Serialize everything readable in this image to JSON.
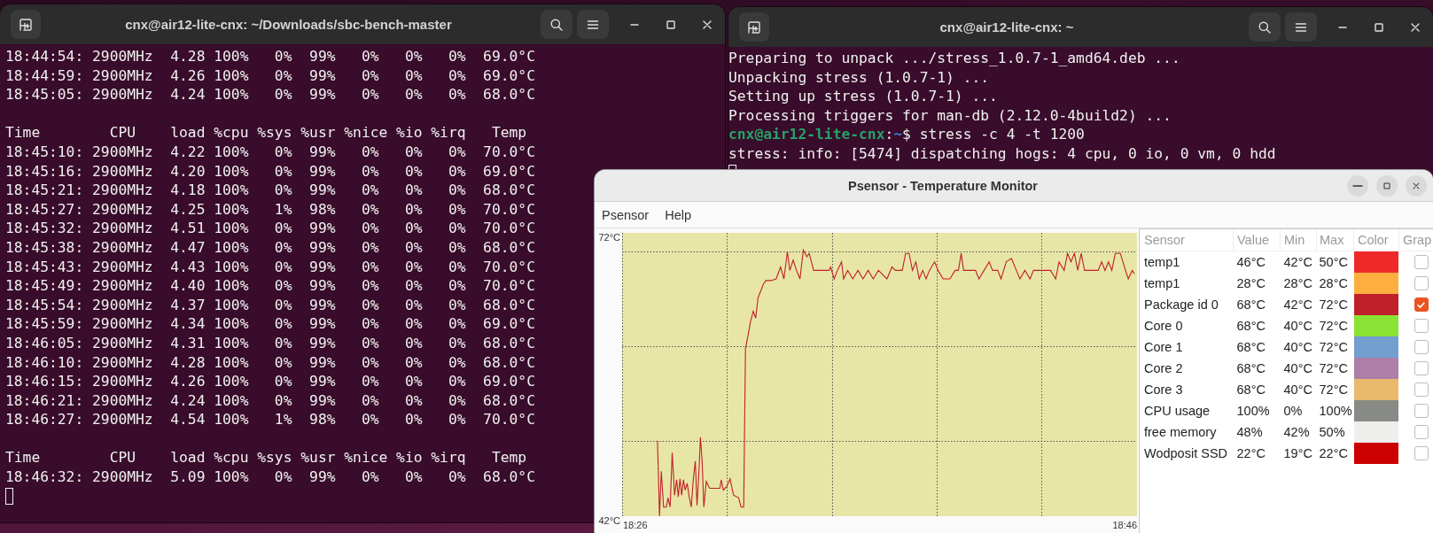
{
  "terminals": [
    {
      "title": "cnx@air12-lite-cnx: ~/Downloads/sbc-bench-master",
      "lines": [
        {
          "kind": "output",
          "text": "18:44:54: 2900MHz  4.28 100%   0%  99%   0%   0%   0%  69.0°C"
        },
        {
          "kind": "output",
          "text": "18:44:59: 2900MHz  4.26 100%   0%  99%   0%   0%   0%  69.0°C"
        },
        {
          "kind": "output",
          "text": "18:45:05: 2900MHz  4.24 100%   0%  99%   0%   0%   0%  68.0°C"
        },
        {
          "kind": "blank"
        },
        {
          "kind": "output",
          "text": "Time        CPU    load %cpu %sys %usr %nice %io %irq   Temp"
        },
        {
          "kind": "output",
          "text": "18:45:10: 2900MHz  4.22 100%   0%  99%   0%   0%   0%  70.0°C"
        },
        {
          "kind": "output",
          "text": "18:45:16: 2900MHz  4.20 100%   0%  99%   0%   0%   0%  69.0°C"
        },
        {
          "kind": "output",
          "text": "18:45:21: 2900MHz  4.18 100%   0%  99%   0%   0%   0%  68.0°C"
        },
        {
          "kind": "output",
          "text": "18:45:27: 2900MHz  4.25 100%   1%  98%   0%   0%   0%  70.0°C"
        },
        {
          "kind": "output",
          "text": "18:45:32: 2900MHz  4.51 100%   0%  99%   0%   0%   0%  70.0°C"
        },
        {
          "kind": "output",
          "text": "18:45:38: 2900MHz  4.47 100%   0%  99%   0%   0%   0%  68.0°C"
        },
        {
          "kind": "output",
          "text": "18:45:43: 2900MHz  4.43 100%   0%  99%   0%   0%   0%  70.0°C"
        },
        {
          "kind": "output",
          "text": "18:45:49: 2900MHz  4.40 100%   0%  99%   0%   0%   0%  70.0°C"
        },
        {
          "kind": "output",
          "text": "18:45:54: 2900MHz  4.37 100%   0%  99%   0%   0%   0%  68.0°C"
        },
        {
          "kind": "output",
          "text": "18:45:59: 2900MHz  4.34 100%   0%  99%   0%   0%   0%  69.0°C"
        },
        {
          "kind": "output",
          "text": "18:46:05: 2900MHz  4.31 100%   0%  99%   0%   0%   0%  68.0°C"
        },
        {
          "kind": "output",
          "text": "18:46:10: 2900MHz  4.28 100%   0%  99%   0%   0%   0%  68.0°C"
        },
        {
          "kind": "output",
          "text": "18:46:15: 2900MHz  4.26 100%   0%  99%   0%   0%   0%  69.0°C"
        },
        {
          "kind": "output",
          "text": "18:46:21: 2900MHz  4.24 100%   0%  99%   0%   0%   0%  68.0°C"
        },
        {
          "kind": "output",
          "text": "18:46:27: 2900MHz  4.54 100%   1%  98%   0%   0%   0%  70.0°C"
        },
        {
          "kind": "blank"
        },
        {
          "kind": "output",
          "text": "Time        CPU    load %cpu %sys %usr %nice %io %irq   Temp"
        },
        {
          "kind": "output",
          "text": "18:46:32: 2900MHz  5.09 100%   0%  99%   0%   0%   0%  68.0°C"
        },
        {
          "kind": "cursor"
        }
      ]
    },
    {
      "title": "cnx@air12-lite-cnx: ~",
      "lines": [
        {
          "kind": "output",
          "text": "Preparing to unpack .../stress_1.0.7-1_amd64.deb ..."
        },
        {
          "kind": "output",
          "text": "Unpacking stress (1.0.7-1) ..."
        },
        {
          "kind": "output",
          "text": "Setting up stress (1.0.7-1) ..."
        },
        {
          "kind": "output",
          "text": "Processing triggers for man-db (2.12.0-4build2) ..."
        },
        {
          "kind": "prompt",
          "user": "cnx@air12-lite-cnx",
          "separator": ":",
          "path": "~",
          "command": "$ stress -c 4 -t 1200"
        },
        {
          "kind": "output",
          "text": "stress: info: [5474] dispatching hogs: 4 cpu, 0 io, 0 vm, 0 hdd"
        },
        {
          "kind": "cursor"
        }
      ]
    }
  ],
  "psensor": {
    "title": "Psensor - Temperature Monitor",
    "menu": [
      "Psensor",
      "Help"
    ],
    "graph": {
      "y_labels": [
        "72°C",
        "42°C"
      ],
      "x_labels": [
        "18:26",
        "18:46"
      ]
    },
    "table": {
      "columns": [
        "Sensor",
        "Value",
        "Min",
        "Max",
        "Color",
        "Grap"
      ],
      "rows": [
        {
          "sensor": "temp1",
          "value": "46°C",
          "min": "42°C",
          "max": "50°C",
          "color": "#ef2929",
          "graph": false
        },
        {
          "sensor": "temp1",
          "value": "28°C",
          "min": "28°C",
          "max": "28°C",
          "color": "#fcaf3e",
          "graph": false
        },
        {
          "sensor": "Package id 0",
          "value": "68°C",
          "min": "42°C",
          "max": "72°C",
          "color": "#c0202a",
          "graph": true
        },
        {
          "sensor": "Core 0",
          "value": "68°C",
          "min": "40°C",
          "max": "72°C",
          "color": "#8ae234",
          "graph": false
        },
        {
          "sensor": "Core 1",
          "value": "68°C",
          "min": "40°C",
          "max": "72°C",
          "color": "#729fcf",
          "graph": false
        },
        {
          "sensor": "Core 2",
          "value": "68°C",
          "min": "40°C",
          "max": "72°C",
          "color": "#ad7fa8",
          "graph": false
        },
        {
          "sensor": "Core 3",
          "value": "68°C",
          "min": "40°C",
          "max": "72°C",
          "color": "#e9b96e",
          "graph": false
        },
        {
          "sensor": "CPU usage",
          "value": "100%",
          "min": "0%",
          "max": "100%",
          "color": "#888a85",
          "graph": false
        },
        {
          "sensor": "free memory",
          "value": "48%",
          "min": "42%",
          "max": "50%",
          "color": "#eeeeec",
          "graph": false
        },
        {
          "sensor": "Wodposit SSD",
          "value": "22°C",
          "min": "19°C",
          "max": "22°C",
          "color": "#cc0000",
          "graph": false
        }
      ]
    }
  }
}
